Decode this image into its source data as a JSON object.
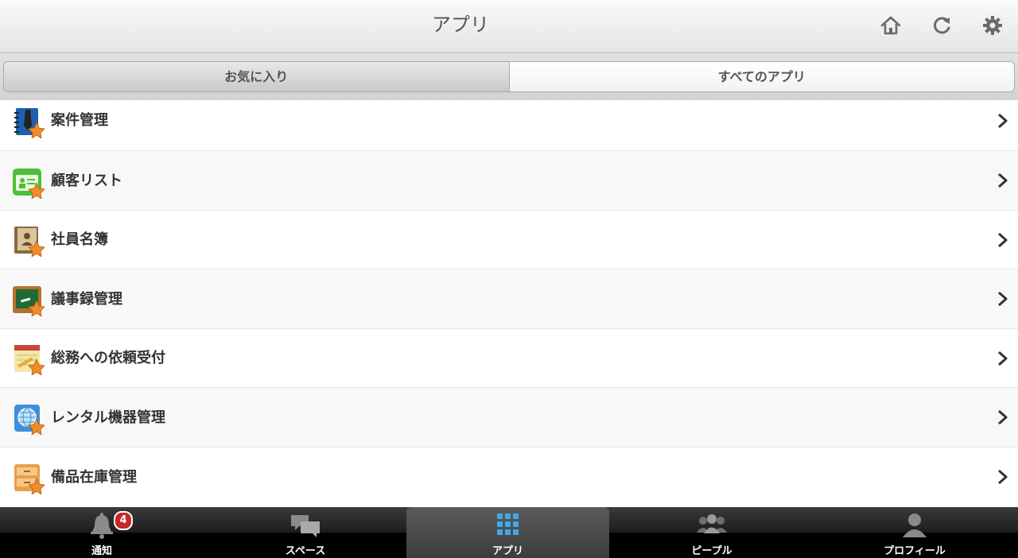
{
  "header": {
    "title": "アプリ",
    "buttons": [
      "home-icon",
      "refresh-icon",
      "gear-icon"
    ]
  },
  "tabs": {
    "favorites": "お気に入り",
    "all_apps": "すべてのアプリ",
    "selected": "favorites"
  },
  "apps": [
    {
      "label": "案件管理",
      "icon": "notebook-pen-icon"
    },
    {
      "label": "顧客リスト",
      "icon": "contact-card-icon"
    },
    {
      "label": "社員名簿",
      "icon": "address-book-icon"
    },
    {
      "label": "議事録管理",
      "icon": "chalkboard-icon"
    },
    {
      "label": "総務への依頼受付",
      "icon": "notepad-pencil-icon"
    },
    {
      "label": "レンタル機器管理",
      "icon": "globe-icon"
    },
    {
      "label": "備品在庫管理",
      "icon": "file-drawer-icon"
    }
  ],
  "tabbar": {
    "items": [
      {
        "label": "通知",
        "icon": "bell-icon",
        "badge": "4"
      },
      {
        "label": "スペース",
        "icon": "chat-bubbles-icon"
      },
      {
        "label": "アプリ",
        "icon": "app-grid-icon",
        "active": true
      },
      {
        "label": "ピープル",
        "icon": "people-icon"
      },
      {
        "label": "プロフィール",
        "icon": "person-icon"
      }
    ]
  },
  "colors": {
    "badge": "#c62727",
    "tabbar": "#000000",
    "accent_blue": "#3fa6e8",
    "star": "#f28c28"
  }
}
